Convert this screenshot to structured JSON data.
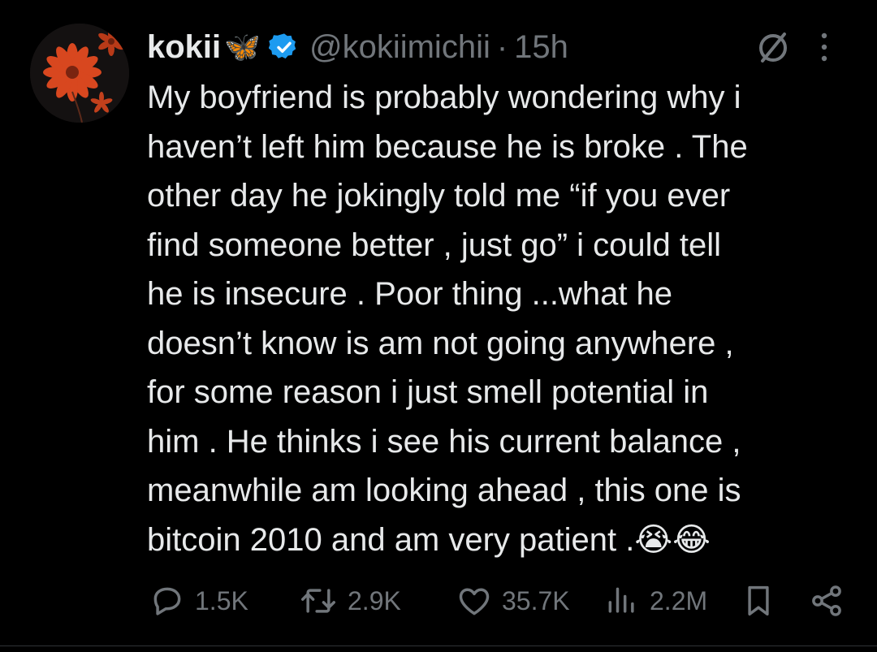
{
  "post": {
    "author": {
      "display_name": "kokii",
      "name_emoji": "🦋",
      "verified_icon": "verified-badge-icon",
      "handle": "@kokiimichii",
      "separator": "·",
      "time": "15h",
      "avatar_icon": "orange-flower-avatar"
    },
    "text": "My boyfriend is probably wondering why i\nhaven’t left him because he is broke . The\nother day he jokingly told me “if you ever\nfind someone better , just go” i could tell\nhe is insecure . Poor thing ...what he\ndoesn’t know is am not going anywhere ,\nfor some reason i just smell potential in\nhim . He thinks i see his current balance ,\nmeanwhile am looking ahead , this one is\nbitcoin 2010 and am very patient .😭😂",
    "stats": {
      "replies": "1.5K",
      "reposts": "2.9K",
      "likes": "35.7K",
      "views": "2.2M"
    },
    "icons": {
      "grok": "grok-icon",
      "more": "more-vertical-icon",
      "reply": "reply-icon",
      "repost": "repost-icon",
      "like": "heart-icon",
      "views": "views-icon",
      "bookmark": "bookmark-icon",
      "share": "share-icon"
    },
    "colors": {
      "background": "#000000",
      "text": "#e7e9ea",
      "muted": "#71767b",
      "verified": "#1d9bf0"
    }
  }
}
